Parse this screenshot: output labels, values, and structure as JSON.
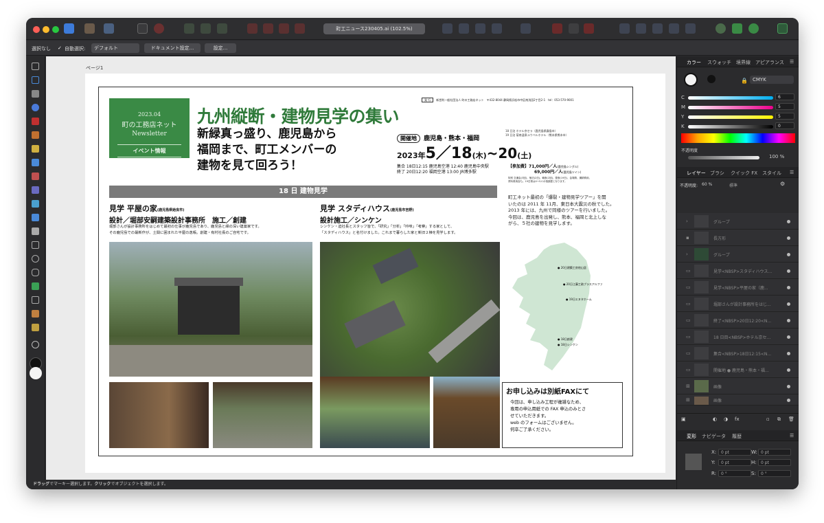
{
  "app": {
    "document_title": "町工ニュース230405.ai (102.5%)",
    "status": {
      "bold1": "ドラッグ",
      "t1": "でマーキー選択します。",
      "bold2": "クリック",
      "t2": "でオブジェクトを選択します。"
    }
  },
  "context_bar": {
    "no_selection": "選択なし",
    "auto_select": "自動選択:",
    "default_select": "デフォルト",
    "doc_settings": "ドキュメント設定...",
    "settings": "設定..."
  },
  "canvas": {
    "page_label": "ページ1"
  },
  "right_panel": {
    "color_tabs": [
      "カラー",
      "スウォッチ",
      "境界線",
      "アピアランス"
    ],
    "color_model": "CMYK",
    "channels": [
      {
        "k": "C",
        "v": "6"
      },
      {
        "k": "M",
        "v": "5"
      },
      {
        "k": "Y",
        "v": "5"
      },
      {
        "k": "K",
        "v": "0"
      }
    ],
    "opacity_label": "不透明度",
    "opacity": "100 %",
    "layer_tabs": [
      "レイヤー",
      "ブラシ",
      "クイック FX",
      "スタイル"
    ],
    "layer_opacity_label": "不透明度:",
    "layer_opacity": "60 %",
    "blend_mode": "標準",
    "layers": [
      "グループ",
      "長方形",
      "グループ",
      "見学<NBSP>スタディハウス...",
      "見学<NBSP>平屋の家（鹿...",
      "堀部さんが設計事務所をはじ...",
      "終了<NBSP>20日12:20<N...",
      "18 日目<NBSP>ホテル京セ...",
      "集合<NBSP>18日12:15<N...",
      "開催地 ● 鹿児島・熊本・福...",
      "画像",
      "画像"
    ],
    "transform_tabs": [
      "変形",
      "ナビゲータ",
      "履歴"
    ],
    "transform": {
      "x": "0 pt",
      "y": "0 pt",
      "w": "0 pt",
      "h": "0 pt",
      "r": "0 °",
      "s": "0 °"
    }
  },
  "doc": {
    "issuer_tag": "発 行",
    "issuer_line1": "新営利一般社団法人 町の工務店ネット　〒432-8044 静岡県浜松市中区南浅田2丁目2-1　tel：053-570-9001",
    "green_date": "2023.04",
    "green_title": "町の工務店ネット",
    "green_newsletter": "Newsletter",
    "green_event": "イベント情報",
    "main_title": "九州縦断・建物見学の集い",
    "subtitle1": "新緑真っ盛り、鹿児島から",
    "subtitle2": "福岡まで、町工メンバーの",
    "subtitle3": "建物を見て回ろう！",
    "venue_tag": "開催地",
    "venue": "鹿児島・熊本・福岡",
    "hotel1": "18 日泊 ホテル京セラ（鹿児島県霧島市）",
    "hotel2": "19 日泊 菊南温泉ユウベルホテル（熊本県熊本市）",
    "date_year": "2023年",
    "date_main": "5／18",
    "date_thu": "(木)",
    "date_end": "~20",
    "date_sat": "(土)",
    "gather": "集合 18日12:15 鹿児島空港 12:40 鹿児島中央駅",
    "end": "終了 20日12:20 福岡空港 13:00 JR博多駅",
    "fee_label": "【参加費】",
    "fee1": "71,000円／人",
    "fee1_note": "(鹿児島シングル)",
    "fee2": "69,000円／人",
    "fee2_note": "(鹿児島ツイン)",
    "fee_fine1": "特別 交通会(3回)、宿泊(2泊)、朝食(2回)、昼食(19日)、会場費、講師費用、",
    "fee_fine2": "資料費用含も。19日夜は4～5人の相部屋となります。",
    "section_day": "18 日  建物見学",
    "h1_title": "見学 平屋の家",
    "h1_loc": "(鹿児島県姶良市)",
    "h1_design": "設計／堀部安嗣建築設計事務所　施工／創建",
    "h1_body1": "堀部さんが設計事務所をはじめて最初の仕事が鹿児島であり、鹿児島と縁の深い建築家です。",
    "h1_body2": "その鹿児島での最新作が、土間に囲まれた平屋の逸帳。創建・有村社長のご自宅です。",
    "h2_title": "見学 スタディハウス",
    "h2_loc": "(鹿児島市吉野)",
    "h2_design": "設計施工／シンケン",
    "h2_body1": "シンケン・迫社長とスタッフ皆で、「研究」「分析」「吟味」「考察」する家として、",
    "h2_body2": "「スタディハウス」と名付けました。これまで暮らした家と新旧２棟を見学します。",
    "intro1": "町工ネット最初の「爆裂・建物見学ツアー」を開",
    "intro2": "いたのは 2011 年 11月、東日本大震災の秋でした。",
    "intro3": "2013 年には、九州で同様のツアーを行いました。",
    "intro4": "今回は、鹿児島を出発し、熊本、福岡と北上しな",
    "intro5": "がら、５社の建物を見学します。",
    "map_labels": [
      "20日建築工房他山居",
      "20日江藤工務プラスアルファ",
      "19日エヌタホーム",
      "18日創建",
      "18日シンケン"
    ],
    "fax_title": "お申し込みは別紙FAXにて",
    "fax1": "今回は、申し込み工程が複雑なため、",
    "fax2": "専用の申込用紙での FAX 申込のみとさ",
    "fax3": "せていただきます。",
    "fax4": "web のフォームはございません。",
    "fax5": "何卒ご了承ください。"
  }
}
